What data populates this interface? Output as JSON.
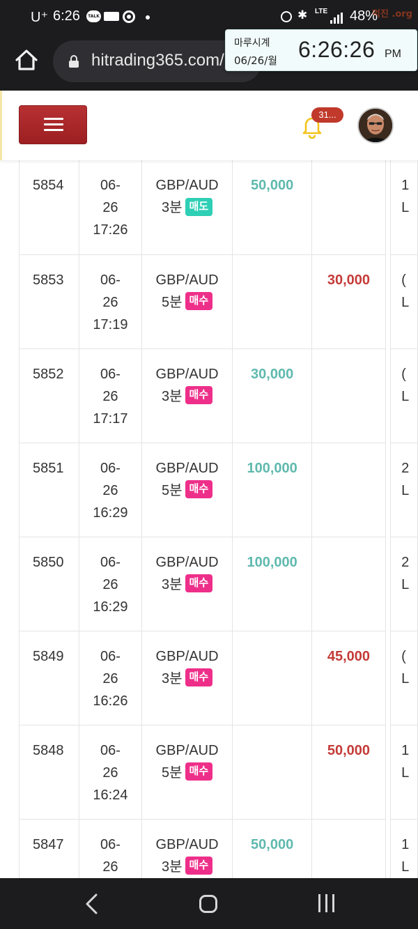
{
  "status_bar": {
    "carrier": "U⁺",
    "time": "6:26",
    "talk_label": "TALK",
    "network": "LTE",
    "battery": "48%",
    "watermark": "먹진 .org"
  },
  "browser": {
    "url": "hitrading365.com/"
  },
  "clock_widget": {
    "title": "마루시계",
    "date": "06/26/월",
    "time": "6:26:26",
    "ampm": "PM"
  },
  "header": {
    "notification_count": "31..."
  },
  "colors": {
    "header_button": "#9c1f22",
    "win_amount": "#5fb9ae",
    "lose_amount": "#c43b38",
    "sell_badge": "#2ecfb5",
    "buy_badge": "#ee2f8a"
  },
  "table": {
    "rows": [
      {
        "id": "5854",
        "date": "06-",
        "day": "26",
        "time": "17:26",
        "pair": "GBP/AUD",
        "duration": "3분",
        "side": "매도",
        "side_type": "sell",
        "win": "50,000",
        "lose": "",
        "extra1": "1",
        "extra2": "L"
      },
      {
        "id": "5853",
        "date": "06-",
        "day": "26",
        "time": "17:19",
        "pair": "GBP/AUD",
        "duration": "5분",
        "side": "매수",
        "side_type": "buy",
        "win": "",
        "lose": "30,000",
        "extra1": "(",
        "extra2": "L"
      },
      {
        "id": "5852",
        "date": "06-",
        "day": "26",
        "time": "17:17",
        "pair": "GBP/AUD",
        "duration": "3분",
        "side": "매수",
        "side_type": "buy",
        "win": "30,000",
        "lose": "",
        "extra1": "(",
        "extra2": "L"
      },
      {
        "id": "5851",
        "date": "06-",
        "day": "26",
        "time": "16:29",
        "pair": "GBP/AUD",
        "duration": "5분",
        "side": "매수",
        "side_type": "buy",
        "win": "100,000",
        "lose": "",
        "extra1": "2",
        "extra2": "L"
      },
      {
        "id": "5850",
        "date": "06-",
        "day": "26",
        "time": "16:29",
        "pair": "GBP/AUD",
        "duration": "3분",
        "side": "매수",
        "side_type": "buy",
        "win": "100,000",
        "lose": "",
        "extra1": "2",
        "extra2": "L"
      },
      {
        "id": "5849",
        "date": "06-",
        "day": "26",
        "time": "16:26",
        "pair": "GBP/AUD",
        "duration": "3분",
        "side": "매수",
        "side_type": "buy",
        "win": "",
        "lose": "45,000",
        "extra1": "(",
        "extra2": "L"
      },
      {
        "id": "5848",
        "date": "06-",
        "day": "26",
        "time": "16:24",
        "pair": "GBP/AUD",
        "duration": "5분",
        "side": "매수",
        "side_type": "buy",
        "win": "",
        "lose": "50,000",
        "extra1": "1",
        "extra2": "L"
      },
      {
        "id": "5847",
        "date": "06-",
        "day": "26",
        "time": "",
        "pair": "GBP/AUD",
        "duration": "3분",
        "side": "매수",
        "side_type": "buy",
        "win": "50,000",
        "lose": "",
        "extra1": "1",
        "extra2": "L"
      }
    ]
  }
}
